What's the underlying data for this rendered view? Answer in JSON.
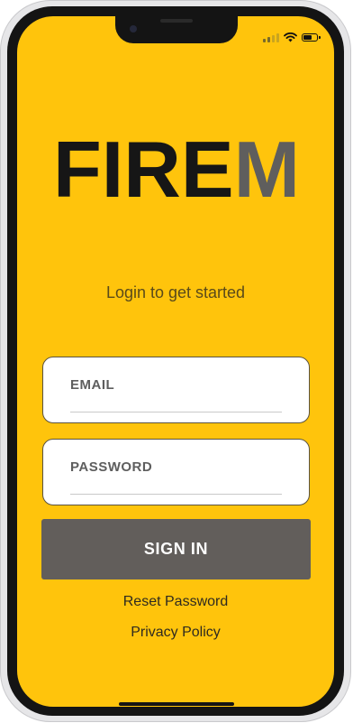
{
  "brand": {
    "logo_text": "FIREM",
    "colors": {
      "background": "#ffc40c",
      "logo_dark": "#161616",
      "logo_accent": "#5f5e5d",
      "button": "#625e5b"
    }
  },
  "status_bar": {
    "icons": [
      "cellular-signal-icon",
      "wifi-icon",
      "battery-icon"
    ],
    "battery_level": 0.7
  },
  "login": {
    "tagline": "Login to get started",
    "email_placeholder": "EMAIL",
    "password_placeholder": "PASSWORD",
    "sign_in_label": "SIGN IN",
    "reset_password_label": "Reset Password",
    "privacy_policy_label": "Privacy Policy"
  }
}
